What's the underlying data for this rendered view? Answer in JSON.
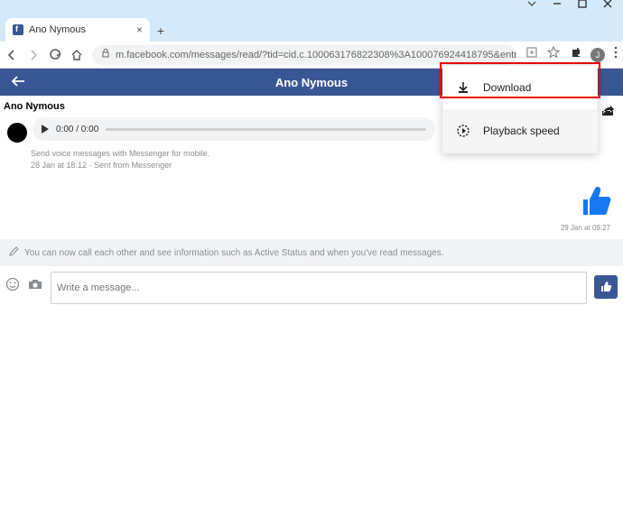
{
  "window": {
    "tab_title": "Ano Nymous",
    "url": "m.facebook.com/messages/read/?tid=cid.c.100063176822308%3A100076924418795&entrypoint=jewel&surface_hie...",
    "avatar_letter": "J"
  },
  "header": {
    "title": "Ano Nymous"
  },
  "conversation": {
    "participant_name": "Ano Nymous",
    "audio_time": "0:00 / 0:00",
    "meta_line1": "Send voice messages with Messenger for mobile.",
    "meta_line2": "28 Jan at 18:12 · Sent from Messenger",
    "like_time": "29 Jan at 09:27",
    "system_info": "You can now call each other and see information such as Active Status and when you've read messages."
  },
  "composer": {
    "placeholder": "Write a message..."
  },
  "context_menu": {
    "download": "Download",
    "playback": "Playback speed"
  }
}
